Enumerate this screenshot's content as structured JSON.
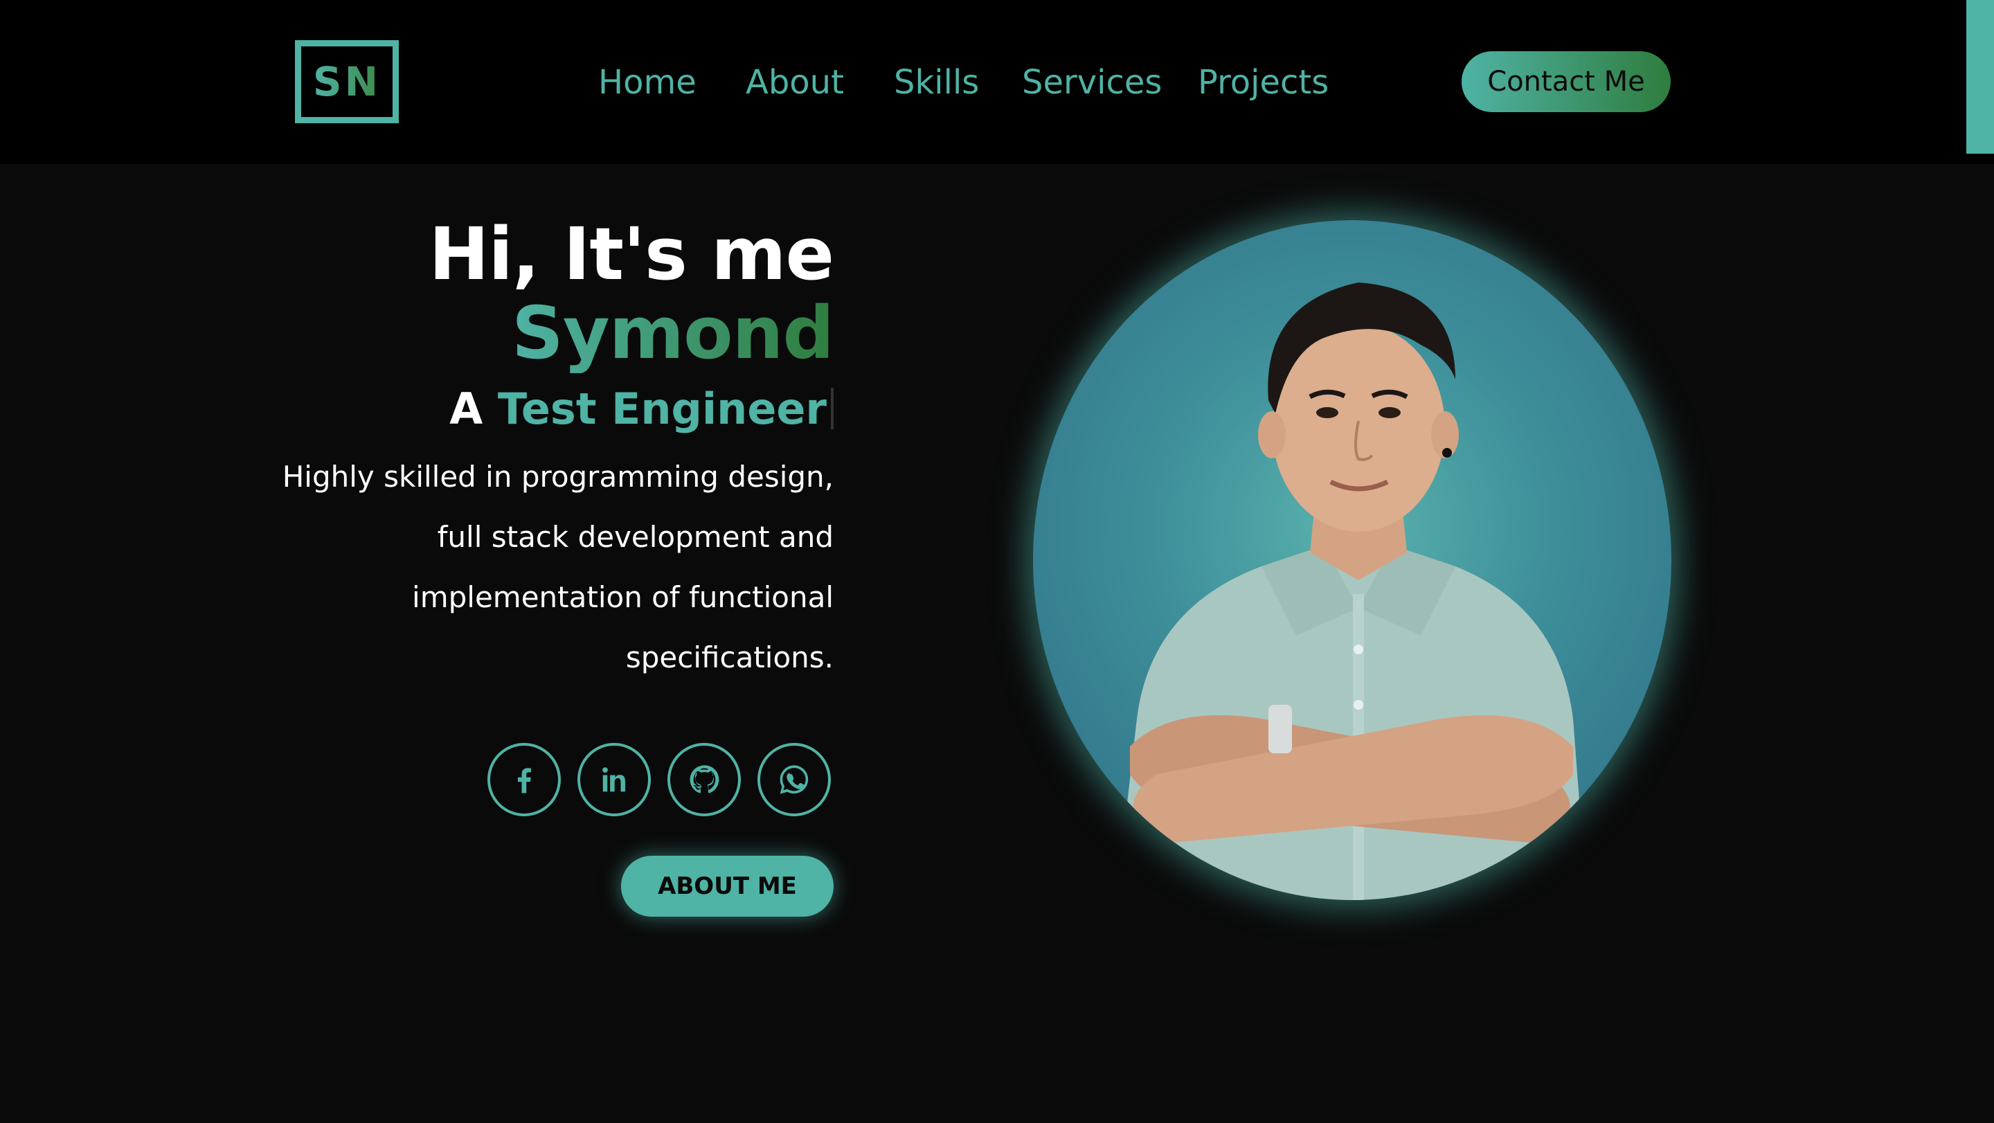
{
  "logo": {
    "text": "SN"
  },
  "nav": {
    "items": [
      {
        "label": "Home"
      },
      {
        "label": "About"
      },
      {
        "label": "Skills"
      },
      {
        "label": "Services"
      },
      {
        "label": "Projects"
      }
    ],
    "contact_label": "Contact Me"
  },
  "hero": {
    "greeting": "Hi, It's me",
    "name": "Symond",
    "role_prefix": "A",
    "role_title": "Test Engineer",
    "description_lines": [
      "Highly skilled in programming design,",
      "full stack development and",
      "implementation of functional",
      "specifications."
    ],
    "about_button": "ABOUT ME"
  },
  "socials": [
    {
      "icon": "facebook-icon"
    },
    {
      "icon": "linkedin-icon"
    },
    {
      "icon": "github-icon"
    },
    {
      "icon": "whatsapp-icon"
    }
  ],
  "colors": {
    "accent": "#4fb3a5",
    "accent_dark": "#2f7d3e",
    "background": "#0a0a0a",
    "header": "#000000"
  }
}
